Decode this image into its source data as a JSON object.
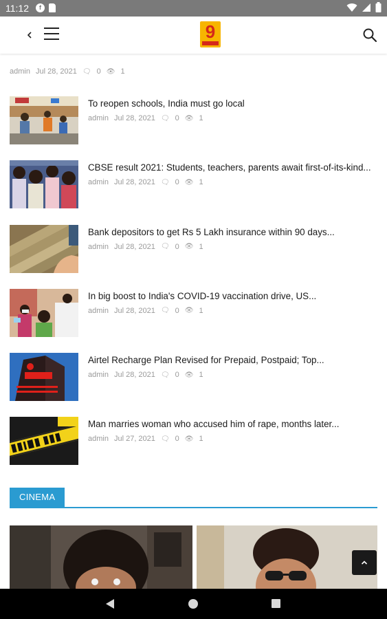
{
  "status_bar": {
    "time": "11:12",
    "left_icons": [
      "facebook-notification-icon",
      "sd-card-icon"
    ],
    "right_icons": [
      "wifi-icon",
      "signal-icon",
      "battery-icon"
    ]
  },
  "app_bar": {
    "logo_text": "9",
    "back_icon": "chevron-left-icon",
    "menu_icon": "hamburger-menu-icon",
    "search_icon": "search-icon"
  },
  "partial_item": {
    "author": "admin",
    "date": "Jul 28, 2021",
    "comments": "0",
    "views": "1"
  },
  "news": [
    {
      "title": "To reopen schools, India must go local",
      "author": "admin",
      "date": "Jul 28, 2021",
      "comments": "0",
      "views": "1"
    },
    {
      "title": "CBSE result 2021: Students, teachers, parents await first-of-its-kind...",
      "author": "admin",
      "date": "Jul 28, 2021",
      "comments": "0",
      "views": "1"
    },
    {
      "title": "Bank depositors to get Rs 5 Lakh insurance within 90 days...",
      "author": "admin",
      "date": "Jul 28, 2021",
      "comments": "0",
      "views": "1"
    },
    {
      "title": "In big boost to India's COVID-19 vaccination drive, US...",
      "author": "admin",
      "date": "Jul 28, 2021",
      "comments": "0",
      "views": "1"
    },
    {
      "title": "Airtel Recharge Plan Revised for Prepaid, Postpaid; Top...",
      "author": "admin",
      "date": "Jul 28, 2021",
      "comments": "0",
      "views": "1"
    },
    {
      "title": "Man marries woman who accused him of rape, months later...",
      "author": "admin",
      "date": "Jul 27, 2021",
      "comments": "0",
      "views": "1"
    }
  ],
  "section": {
    "label": "CINEMA",
    "accent_color": "#2a9bd1"
  },
  "fab": {
    "icon": "chevron-up-icon"
  },
  "nav_bar": {
    "icons": [
      "nav-back-icon",
      "nav-home-icon",
      "nav-recents-icon"
    ]
  }
}
